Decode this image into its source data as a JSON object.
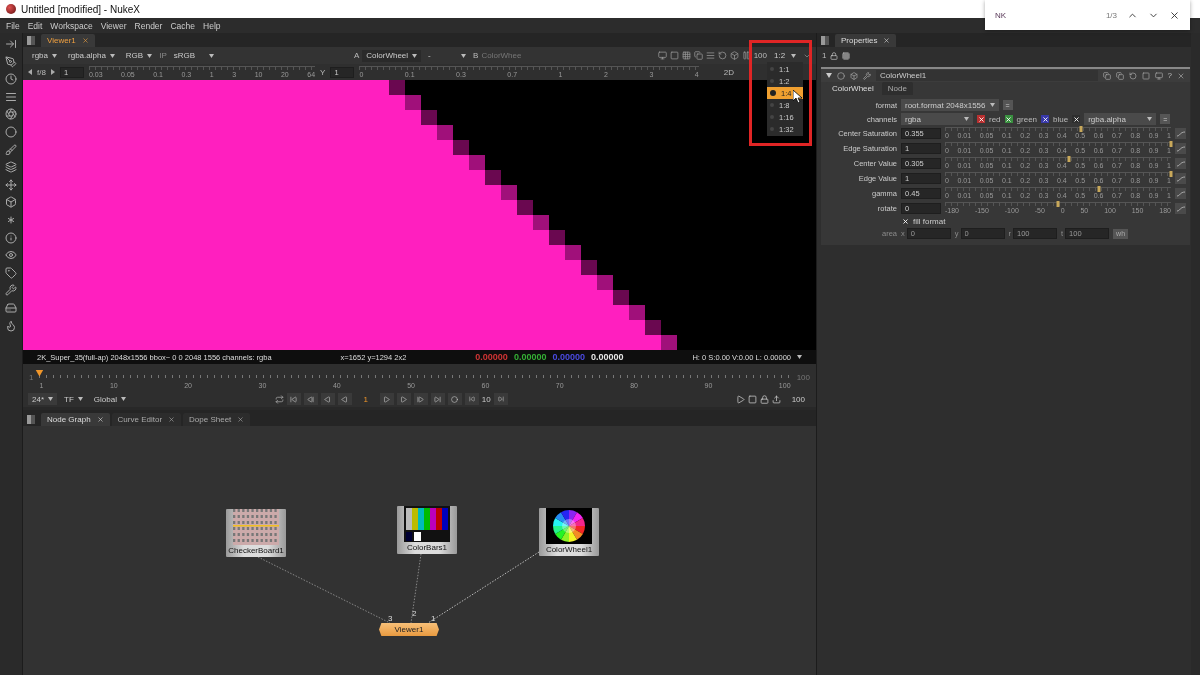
{
  "window": {
    "title": "Untitled [modified] - NukeX"
  },
  "find_bar": {
    "value": "NK",
    "count": "1/3"
  },
  "menu": [
    "File",
    "Edit",
    "Workspace",
    "Viewer",
    "Render",
    "Cache",
    "Help"
  ],
  "viewer": {
    "tabs": [
      {
        "label": "Viewer1",
        "selected": true
      }
    ],
    "controls": {
      "channels": "rgba",
      "alpha": "rgba.alpha",
      "display": "RGB",
      "ip": "IP",
      "lut": "sRGB",
      "a_label": "A",
      "a_input": "ColorWheel",
      "a_op": "-",
      "b_label": "B",
      "b_input": "ColorWhee",
      "fps": "100",
      "zoom": "1:2"
    },
    "gain": {
      "label": "f/8",
      "value": "1",
      "ticks": [
        "0.03",
        "0.05",
        "0.1",
        "0.3",
        "1",
        "3",
        "10",
        "20",
        "64"
      ]
    },
    "gamma": {
      "label": "Y",
      "value": "1",
      "ticks": [
        "0",
        "0.1",
        "0.3",
        "0.7",
        "1",
        "2",
        "3",
        "4"
      ]
    },
    "mode": "2D",
    "zoom_menu": [
      {
        "label": "1:1",
        "selected": false
      },
      {
        "label": "1:2",
        "selected": false
      },
      {
        "label": "1:4",
        "selected": true
      },
      {
        "label": "1:8",
        "selected": false
      },
      {
        "label": "1:16",
        "selected": false
      },
      {
        "label": "1:32",
        "selected": false
      }
    ],
    "info": {
      "format": "2K_Super_35(full-ap) 2048x1556  bbox~ 0 0 2048 1556 channels: rgba",
      "position": "x=1652 y=1294 2x2",
      "pixel": [
        {
          "value": "0.00000",
          "color": "#d03535"
        },
        {
          "value": "0.00000",
          "color": "#35b035"
        },
        {
          "value": "0.00000",
          "color": "#4a4ae0"
        },
        {
          "value": "0.00000",
          "color": "#e8e8e8"
        }
      ],
      "hsvl": "H:  0 S:0.00 V:0.00  L: 0.00000"
    }
  },
  "timeline": {
    "start": "1",
    "end": "100",
    "ticks": [
      "1",
      "10",
      "20",
      "30",
      "40",
      "50",
      "60",
      "70",
      "80",
      "90",
      "100"
    ],
    "level": 0
  },
  "playback": {
    "fps": "24*",
    "time": "TF",
    "scope": "Global",
    "frame": "1",
    "increment": "10",
    "end": "100"
  },
  "graph": {
    "tabs": [
      {
        "label": "Node Graph",
        "selected": true
      },
      {
        "label": "Curve Editor",
        "selected": false
      },
      {
        "label": "Dope Sheet",
        "selected": false
      }
    ],
    "nodes": [
      {
        "kind": "checker",
        "label": "CheckerBoard1"
      },
      {
        "kind": "bars",
        "label": "ColorBars1"
      },
      {
        "kind": "wheel",
        "label": "ColorWheel1"
      },
      {
        "kind": "viewer",
        "label": "Viewer1"
      }
    ],
    "inputs": [
      "3",
      "2",
      "1"
    ]
  },
  "properties": {
    "tabs": [
      {
        "label": "Properties",
        "selected": true
      }
    ],
    "count": "1",
    "node": {
      "name": "ColorWheel1",
      "help": "?",
      "tabs": [
        {
          "label": "ColorWheel",
          "selected": true
        },
        {
          "label": "Node",
          "selected": false
        }
      ],
      "format": {
        "label": "format",
        "value": "root.format 2048x1556",
        "button": "="
      },
      "channels": {
        "label": "channels",
        "value": "rgba",
        "checks": [
          {
            "label": "red",
            "checked": true,
            "color": "#b83030"
          },
          {
            "label": "green",
            "checked": true,
            "color": "#3a9040"
          },
          {
            "label": "blue",
            "checked": true,
            "color": "#3838a8"
          },
          {
            "checked": true,
            "color": "#2e2e2e"
          }
        ],
        "alpha": "rgba.alpha",
        "button": "="
      },
      "knobs": [
        {
          "label": "Center Saturation",
          "value": "0.355",
          "level": 0.6,
          "ticks": [
            "0",
            "0.01",
            "0.05",
            "0.1",
            "0.2",
            "0.3",
            "0.4",
            "0.5",
            "0.6",
            "0.7",
            "0.8",
            "0.9",
            "1"
          ]
        },
        {
          "label": "Edge Saturation",
          "value": "1",
          "level": 1,
          "ticks": [
            "0",
            "0.01",
            "0.05",
            "0.1",
            "0.2",
            "0.3",
            "0.4",
            "0.5",
            "0.6",
            "0.7",
            "0.8",
            "0.9",
            "1"
          ]
        },
        {
          "label": "Center Value",
          "value": "0.305",
          "level": 0.55,
          "ticks": [
            "0",
            "0.01",
            "0.05",
            "0.1",
            "0.2",
            "0.3",
            "0.4",
            "0.5",
            "0.6",
            "0.7",
            "0.8",
            "0.9",
            "1"
          ]
        },
        {
          "label": "Edge Value",
          "value": "1",
          "level": 1,
          "ticks": [
            "0",
            "0.01",
            "0.05",
            "0.1",
            "0.2",
            "0.3",
            "0.4",
            "0.5",
            "0.6",
            "0.7",
            "0.8",
            "0.9",
            "1"
          ]
        },
        {
          "label": "gamma",
          "value": "0.45",
          "level": 0.68,
          "ticks": [
            "0",
            "0.01",
            "0.05",
            "0.1",
            "0.2",
            "0.3",
            "0.4",
            "0.5",
            "0.6",
            "0.7",
            "0.8",
            "0.9",
            "1"
          ]
        },
        {
          "label": "rotate",
          "value": "0",
          "level": 0.5,
          "ticks": [
            "-180",
            "-150",
            "-100",
            "-50",
            "0",
            "50",
            "100",
            "150",
            "180"
          ]
        }
      ],
      "fill": {
        "label": "fill format",
        "checked": true
      },
      "area": {
        "label": "area",
        "disabled": true,
        "fields": [
          {
            "label": "x",
            "value": "0"
          },
          {
            "label": "y",
            "value": "0"
          },
          {
            "label": "r",
            "value": "100"
          },
          {
            "label": "t",
            "value": "100"
          }
        ],
        "button": "wh"
      }
    }
  }
}
